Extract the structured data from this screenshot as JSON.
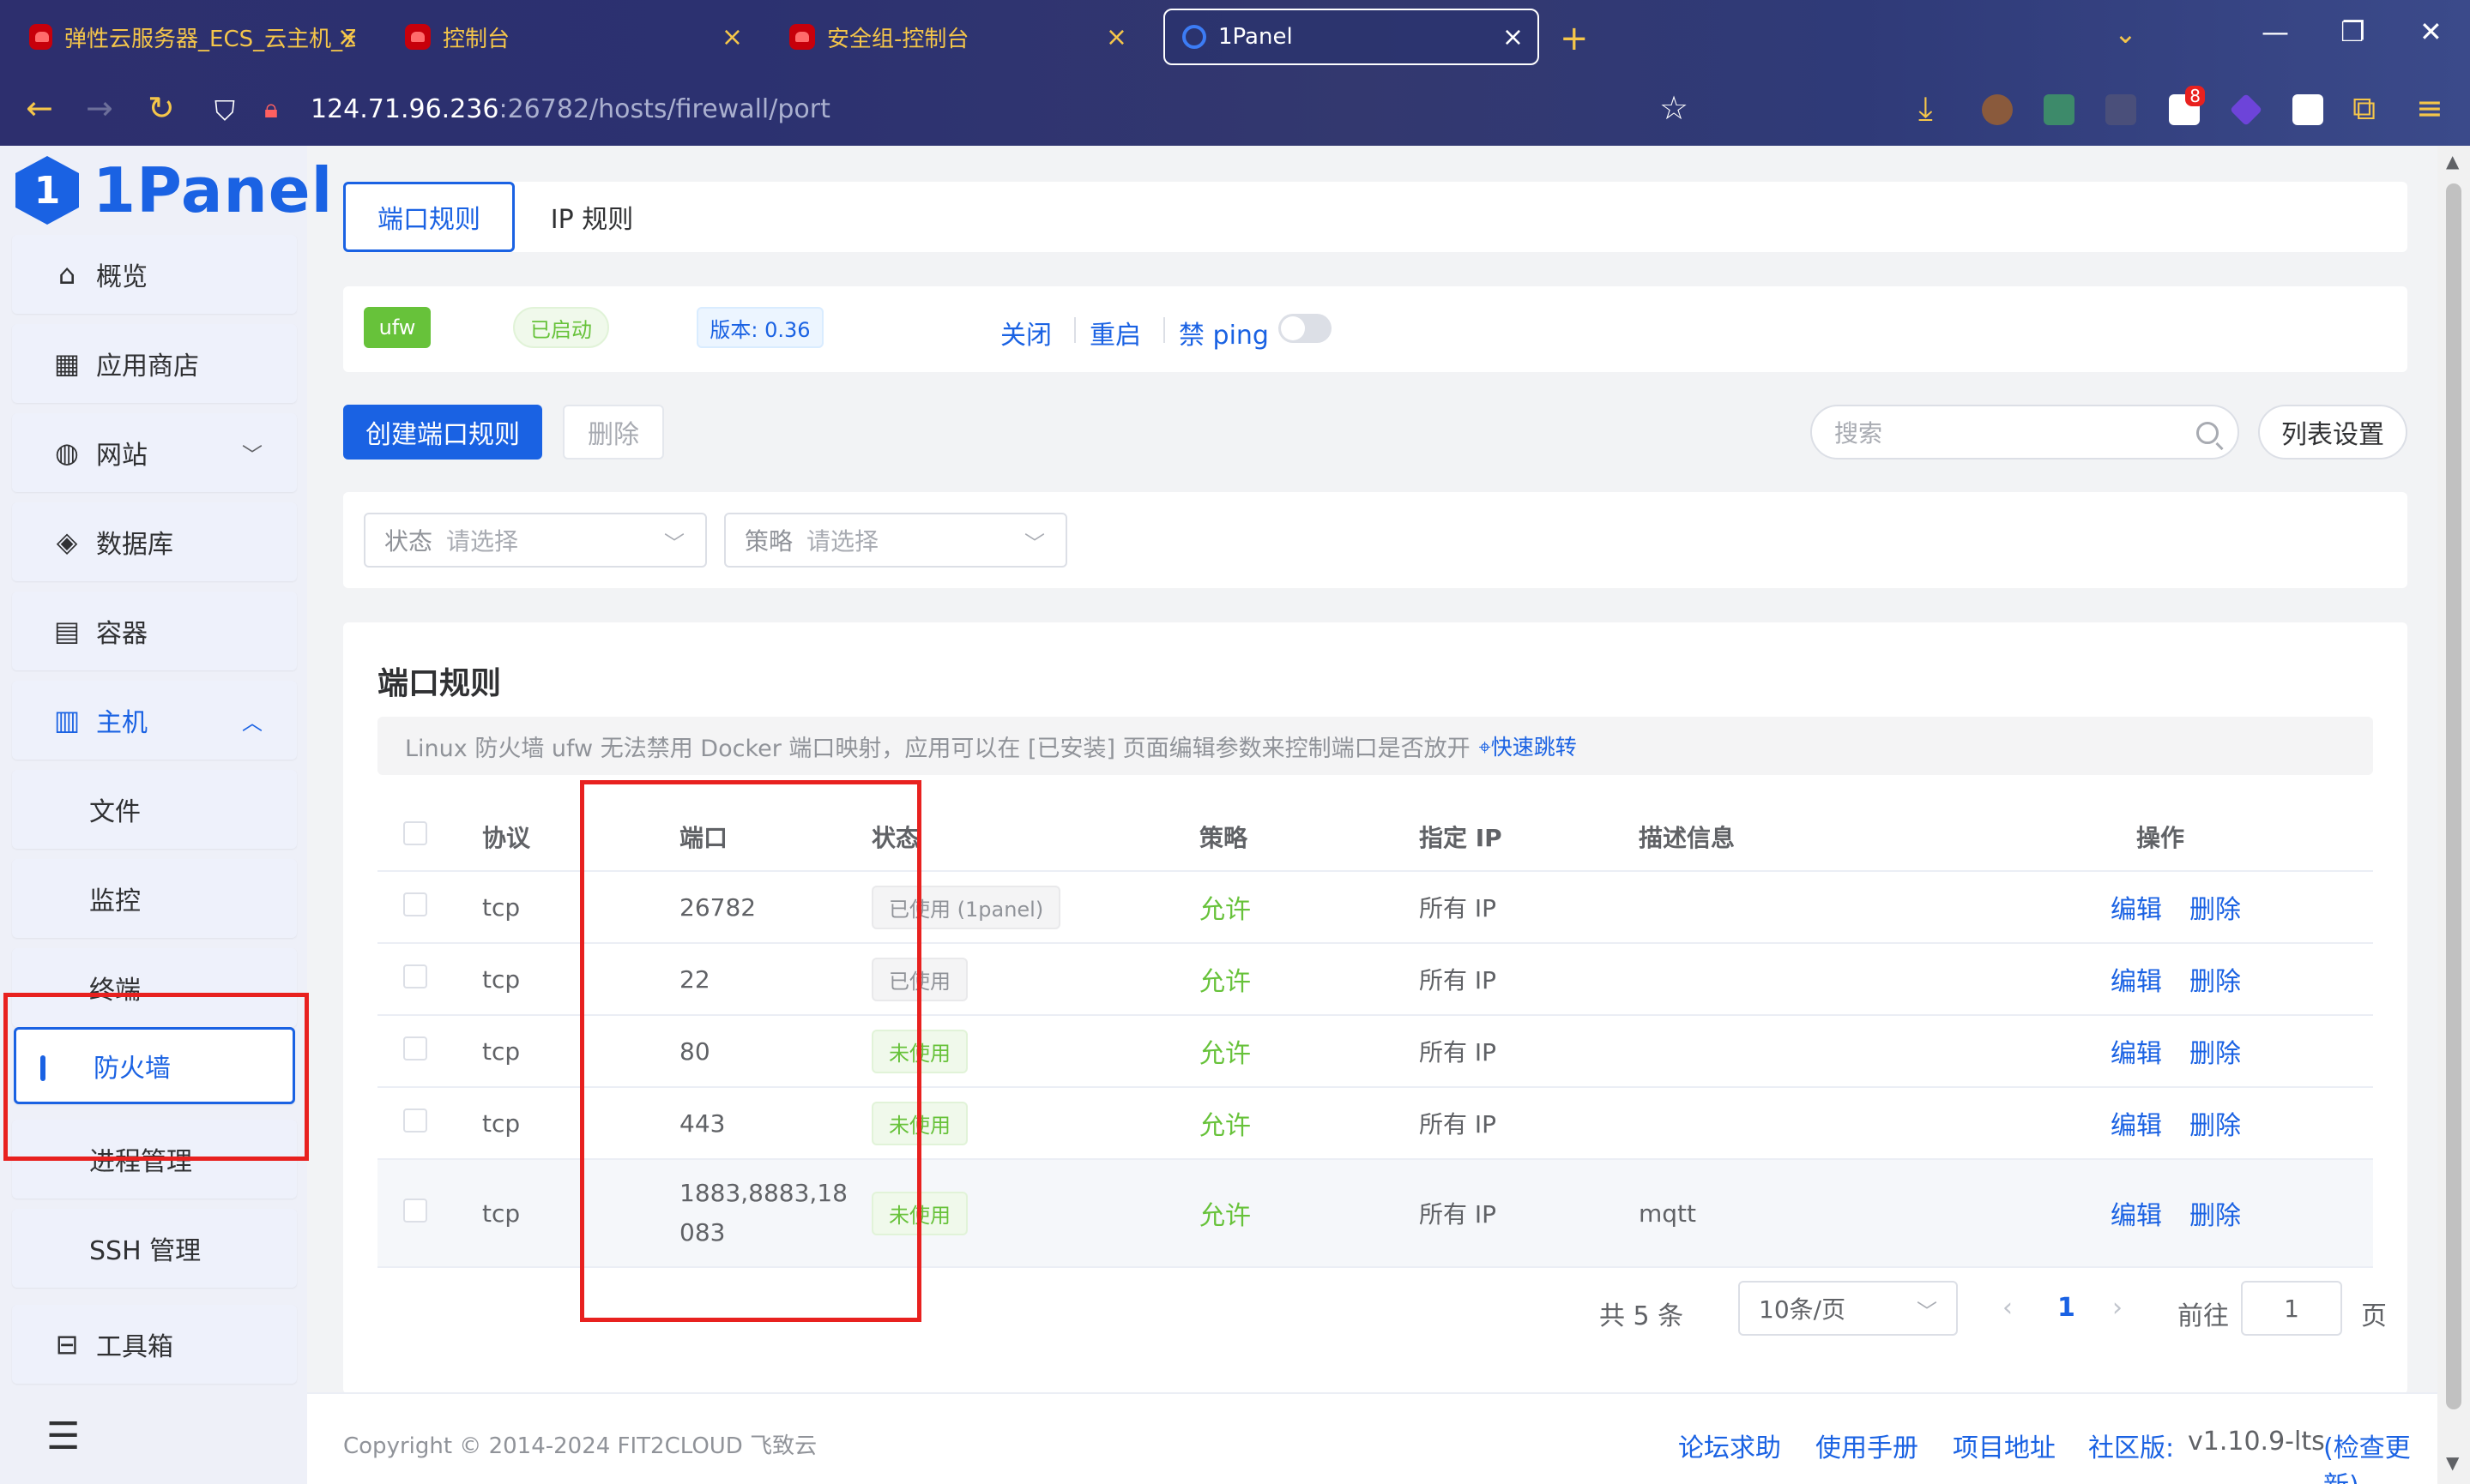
{
  "browser": {
    "tabs": [
      {
        "title": "弹性云服务器_ECS_云主机_云服",
        "favicon": "huawei-cloud-icon"
      },
      {
        "title": "控制台",
        "favicon": "huawei-cloud-icon"
      },
      {
        "title": "安全组-控制台",
        "favicon": "huawei-cloud-icon"
      },
      {
        "title": "1Panel",
        "favicon": "1panel-icon",
        "active": true
      }
    ],
    "url_host": "124.71.96.236",
    "url_rest": ":26782/hosts/firewall/port",
    "notification_badge": "8"
  },
  "brand": {
    "logo_text": "1Panel",
    "logo_mark": "1",
    "accent": "#1a62e3"
  },
  "sidebar": {
    "items": [
      {
        "label": "概览",
        "icon": "home-icon"
      },
      {
        "label": "应用商店",
        "icon": "grid-icon"
      },
      {
        "label": "网站",
        "icon": "globe-icon"
      },
      {
        "label": "数据库",
        "icon": "layers-icon"
      },
      {
        "label": "容器",
        "icon": "docker-icon"
      },
      {
        "label": "主机",
        "icon": "server-icon"
      },
      {
        "label": "文件"
      },
      {
        "label": "监控"
      },
      {
        "label": "终端"
      },
      {
        "label": "防火墙",
        "active": true
      },
      {
        "label": "进程管理"
      },
      {
        "label": "SSH 管理"
      },
      {
        "label": "工具箱",
        "icon": "toolbox-icon"
      }
    ]
  },
  "tabs": {
    "port_rules": "端口规则",
    "ip_rules": "IP 规则"
  },
  "status": {
    "engine": "ufw",
    "state": "已启动",
    "version": "版本: 0.36",
    "close": "关闭",
    "restart": "重启",
    "disable_ping": "禁 ping"
  },
  "toolbar": {
    "create": "创建端口规则",
    "delete": "删除",
    "search_placeholder": "搜索",
    "columns": "列表设置"
  },
  "filters": {
    "status_label": "状态",
    "status_placeholder": "请选择",
    "policy_label": "策略",
    "policy_placeholder": "请选择"
  },
  "section": {
    "title": "端口规则",
    "notice": "Linux 防火墙 ufw 无法禁用 Docker 端口映射，应用可以在 [已安装] 页面编辑参数来控制端口是否放开",
    "notice_link": "快速跳转"
  },
  "table": {
    "headers": {
      "protocol": "协议",
      "port": "端口",
      "status": "状态",
      "policy": "策略",
      "ip": "指定 IP",
      "desc": "描述信息",
      "ops": "操作"
    },
    "rows": [
      {
        "protocol": "tcp",
        "port": "26782",
        "status": "已使用 (1panel)",
        "policy": "允许",
        "ip": "所有 IP",
        "desc": "",
        "edit": "编辑",
        "delete": "删除"
      },
      {
        "protocol": "tcp",
        "port": "22",
        "status": "已使用",
        "policy": "允许",
        "ip": "所有 IP",
        "desc": "",
        "edit": "编辑",
        "delete": "删除"
      },
      {
        "protocol": "tcp",
        "port": "80",
        "status": "未使用",
        "policy": "允许",
        "ip": "所有 IP",
        "desc": "",
        "edit": "编辑",
        "delete": "删除"
      },
      {
        "protocol": "tcp",
        "port": "443",
        "status": "未使用",
        "policy": "允许",
        "ip": "所有 IP",
        "desc": "",
        "edit": "编辑",
        "delete": "删除"
      },
      {
        "protocol": "tcp",
        "port_line1": "1883,8883,18",
        "port_line2": "083",
        "status": "未使用",
        "policy": "允许",
        "ip": "所有 IP",
        "desc": "mqtt",
        "edit": "编辑",
        "delete": "删除"
      }
    ]
  },
  "pagination": {
    "total": "共 5 条",
    "page_size": "10条/页",
    "current": "1",
    "goto_label": "前往",
    "goto_value": "1",
    "page_suffix": "页"
  },
  "footer": {
    "copyright": "Copyright © 2014-2024 FIT2CLOUD 飞致云",
    "forum": "论坛求助",
    "manual": "使用手册",
    "project": "项目地址",
    "edition": "社区版:",
    "version": "v1.10.9-lts",
    "check_update": "(检查更新)"
  }
}
